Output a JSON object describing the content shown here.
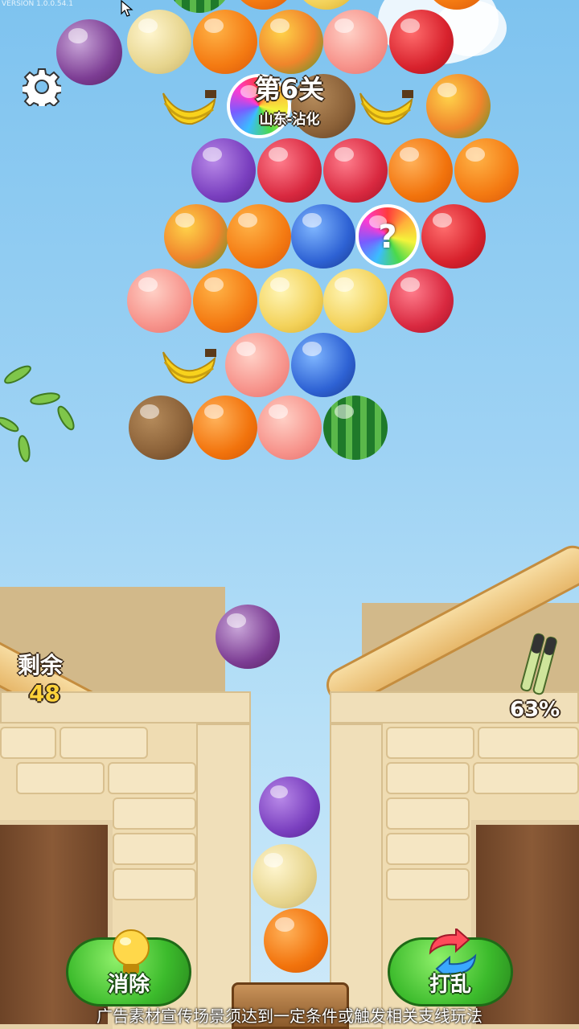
{
  "game": {
    "version": "VERSION 1.0.0.54.1",
    "level_title": "第6关",
    "level_subtitle": "山东-沾化"
  },
  "hud": {
    "remaining_label": "剩余",
    "remaining_count": "48",
    "progress_text": "63%",
    "progress_fraction": 0.63
  },
  "buttons": {
    "eliminate_label": "消除",
    "shuffle_label": "打乱"
  },
  "footer": {
    "disclaimer": "广告素材宣传场景须达到一定条件或触发相关支线玩法"
  },
  "board": {
    "row_1": [
      "onion",
      "melon",
      "orange",
      "mango",
      "peach",
      "pomegranate"
    ],
    "row_2": [
      "banana",
      "mystery",
      "kiwi",
      "banana",
      "mango"
    ],
    "row_3": [
      "grape",
      "raspberry",
      "raspberry",
      "persimmon",
      "orange"
    ],
    "row_4": [
      "mango",
      "orange",
      "blueberry",
      "mystery",
      "pomegranate"
    ],
    "row_5": [
      "peach",
      "orange",
      "pomelo",
      "pomelo",
      "raspberry"
    ],
    "row_6": [
      "banana",
      "peach",
      "blueberry"
    ],
    "row_7": [
      "kiwi",
      "persimmon",
      "peach",
      "watermelon"
    ]
  },
  "falling_fruit": "onion",
  "stack": [
    "grape",
    "melon",
    "persimmon"
  ],
  "icons": [
    "settings-gear-icon",
    "lightbulb-icon",
    "shuffle-arrows-icon",
    "peapod-icon",
    "bamboo-icon",
    "mouse-cursor-icon"
  ],
  "colors": {
    "sky": "#8ecbf2",
    "button_green": "#3cbb2c",
    "roof": "#f0c984",
    "wall": "#efdcb2"
  }
}
